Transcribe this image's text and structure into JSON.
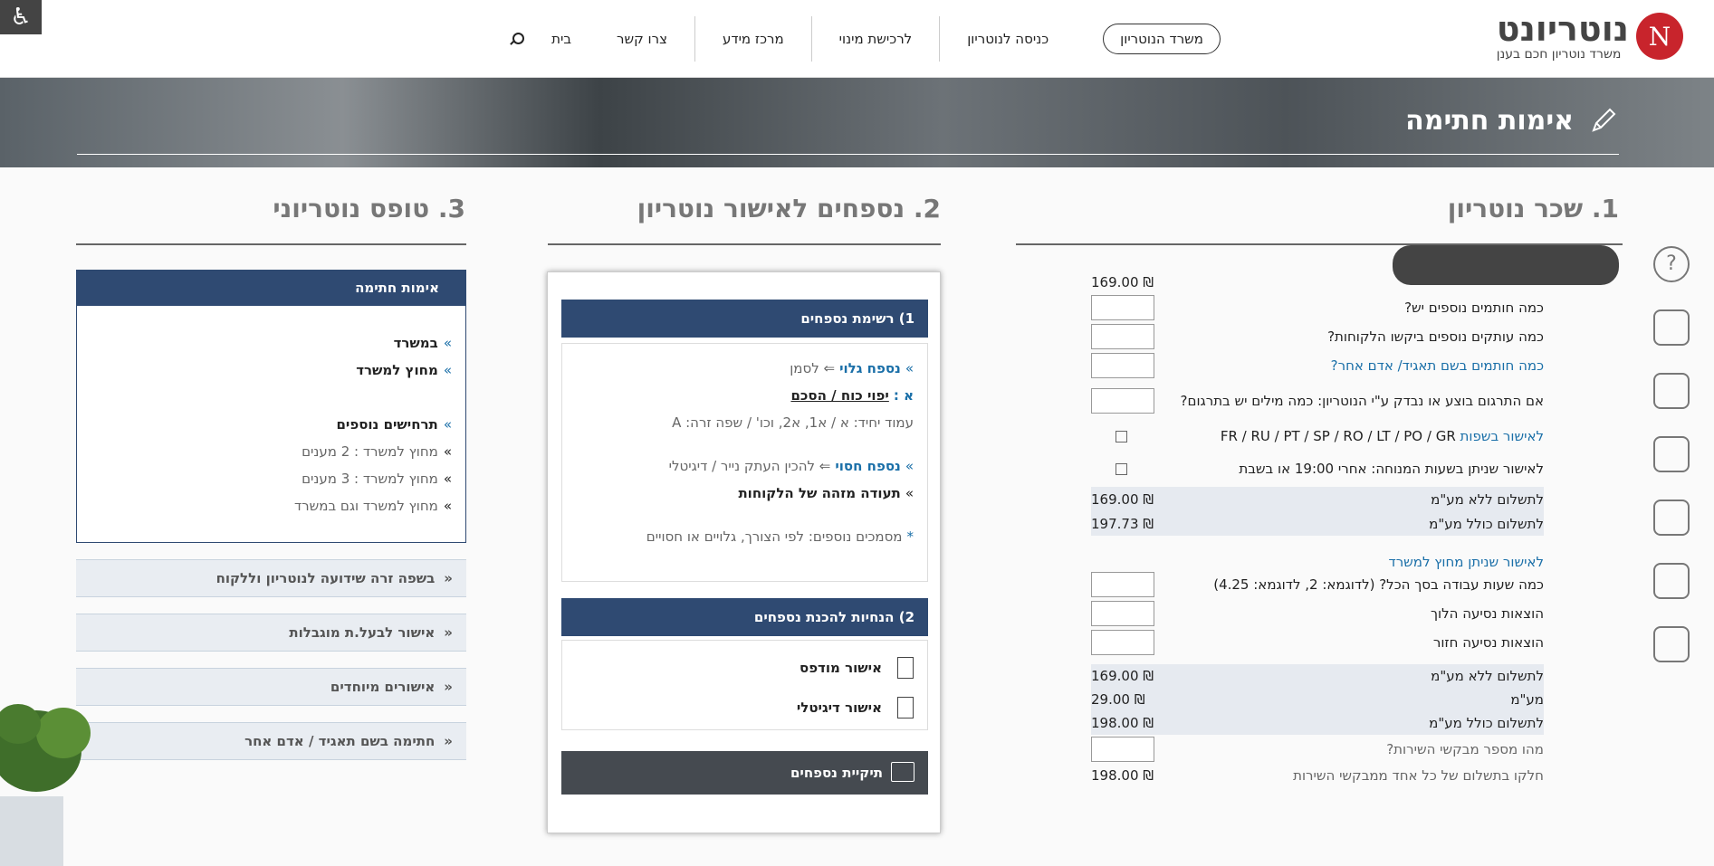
{
  "header": {
    "logo_letter": "N",
    "logo_text": "נוטריונט",
    "logo_sub": "משרד נוטריון חכם בענן",
    "nav_pill": "משרד הנוטריון",
    "nav": [
      "כניסה לנוטריון",
      "לרכישת מינוי",
      "מרכז מידע",
      "צרו קשר"
    ],
    "home": "בית"
  },
  "banner": {
    "title": "אימות חתימה"
  },
  "headings": {
    "fee": "1. שכר נוטריון",
    "docs": "2. נספחים לאישור נוטריון",
    "form": "3. טופס נוטריוני"
  },
  "fee": {
    "first_amount": "169.00 ₪",
    "rows": [
      "כמה חותמים נוספים יש?",
      "כמה עותקים נוספים ביקשו הלקוחות?",
      "כמה חותמים בשם תאגיד/ אדם אחר?",
      "אם התרגום בוצע או נבדק ע\"י הנוטריון: כמה מילים יש בתרגום?"
    ],
    "lang_label": "לאישור בשפות",
    "lang_codes": "FR / RU / PT / SP / RO / LT / PO / GR",
    "afterhours": "לאישור שניתן בשעות המנוחה: אחרי 19:00 או בשבת",
    "sum1": [
      {
        "label": "לתשלום ללא מע\"מ",
        "value": "169.00 ₪"
      },
      {
        "label": "לתשלום כולל מע\"מ",
        "value": "197.73 ₪"
      }
    ],
    "outside_title": "לאישור שניתן מחוץ למשרד",
    "outside_rows": [
      "כמה שעות עבודה בסך הכל? (לדוגמא: 2, לדוגמא: 4.25)",
      "הוצאות נסיעה הלוך",
      "הוצאות נסיעה חזור"
    ],
    "sum2": [
      {
        "label": "לתשלום ללא מע\"מ",
        "value": "169.00 ₪"
      },
      {
        "label": "מע\"מ",
        "value": "29.00 ₪"
      },
      {
        "label": "לתשלום כולל מע\"מ",
        "value": "198.00 ₪"
      }
    ],
    "requesters": "מהו מספר מבקשי השירות?",
    "split": "חלקו בתשלום של כל אחד ממבקשי השירות",
    "split_value": "198.00 ₪"
  },
  "docs": {
    "bar1": "1) רשימת נספחים",
    "a1_link": "נספח גלוי",
    "a1_rest": "⇐ לסמן",
    "a_label": "א :",
    "a_title": "יפוי כוח / הסכם",
    "page_line": "עמוד יחיד: א / א1, א2, וכו' / שפה זרה: A",
    "b_link": "נספח חסוי",
    "b_rest": "⇐ להכין העתק נייר / דיגיטלי",
    "id_doc": "תעודה מזהה של הלקוחות",
    "extra": "מסמכים נוספים: לפי הצורך, גלויים או חסויים",
    "bar2": "2) הנחיות להכנת נספחים",
    "print": "אישור מודפס",
    "digital": "אישור דיגיטלי",
    "download": "תיקיית נספחים"
  },
  "form": {
    "head": "אימות חתימה",
    "items": [
      "במשרד",
      "מחוץ למשרד"
    ],
    "extra_title": "תרחישים נוספים",
    "extra_items": [
      "מחוץ למשרד : 2 מענים",
      "מחוץ למשרד : 3 מענים",
      "מחוץ למשרד וגם במשרד"
    ],
    "accordions": [
      "בשפה זרה שידועה לנוטריון וללקוח",
      "אישור לבעל.ת מוגבלות",
      "אישורים מיוחדים",
      "חתימה בשם תאגיד / אדם אחר"
    ]
  }
}
